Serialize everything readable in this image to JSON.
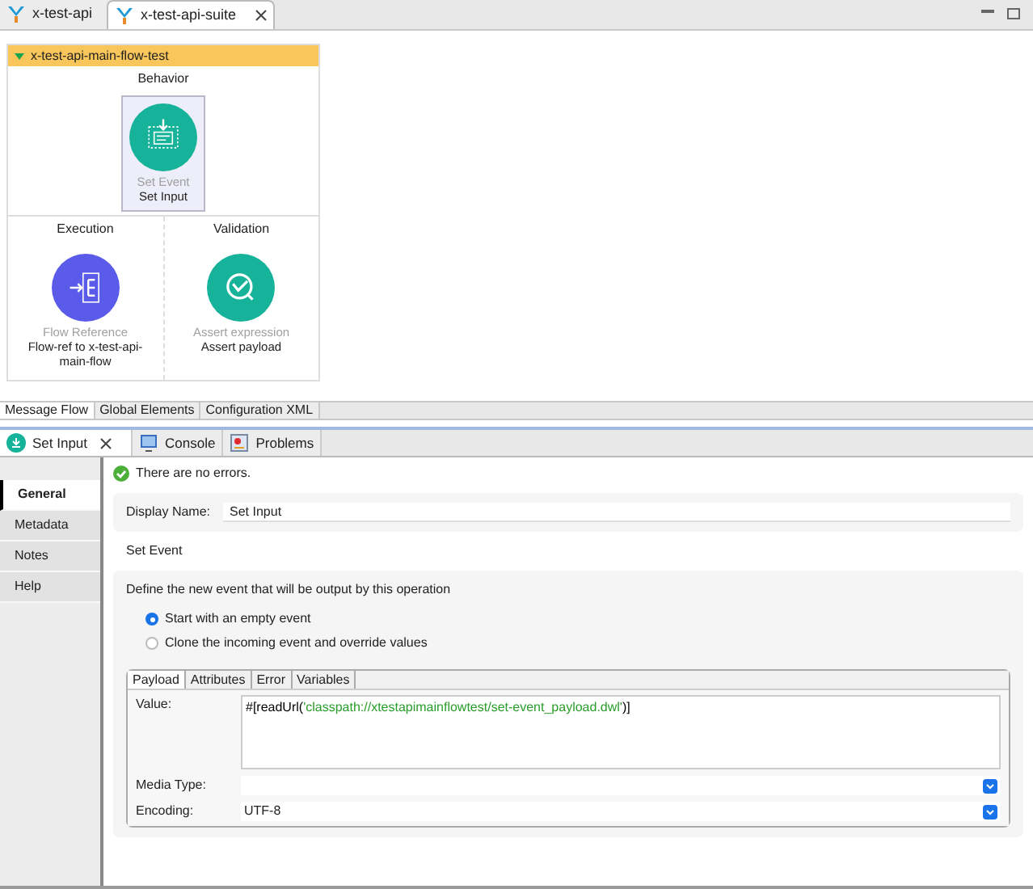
{
  "editor_tabs": [
    {
      "label": "x-test-api",
      "selected": false,
      "closable": false
    },
    {
      "label": "x-test-api-suite",
      "selected": true,
      "closable": true
    }
  ],
  "flow": {
    "title": "x-test-api-main-flow-test",
    "expanded": true,
    "behavior": {
      "heading": "Behavior",
      "kind": "set-event",
      "type": "Set Event",
      "name": "Set Input",
      "selected": true
    },
    "sections": [
      {
        "heading": "Execution",
        "kind": "flow-ref",
        "type": "Flow Reference",
        "name": "Flow-ref to x-test-api-main-flow",
        "selected": false
      },
      {
        "heading": "Validation",
        "kind": "assert",
        "type": "Assert expression",
        "name": "Assert payload",
        "selected": false
      }
    ]
  },
  "canvas_tabs": [
    {
      "label": "Message Flow",
      "selected": true
    },
    {
      "label": "Global Elements",
      "selected": false
    },
    {
      "label": "Configuration XML",
      "selected": false
    }
  ],
  "view_tabs": [
    {
      "label": "Set Input",
      "kind": "set-event",
      "selected": true,
      "closable": true
    },
    {
      "label": "Console",
      "kind": "console",
      "selected": false,
      "closable": false
    },
    {
      "label": "Problems",
      "kind": "problems",
      "selected": false,
      "closable": false
    }
  ],
  "sidebar": {
    "items": [
      {
        "label": "General",
        "selected": true
      },
      {
        "label": "Metadata",
        "selected": false
      },
      {
        "label": "Notes",
        "selected": false
      },
      {
        "label": "Help",
        "selected": false
      }
    ]
  },
  "status": "There are no errors.",
  "display_name": {
    "label": "Display Name:",
    "value": "Set Input"
  },
  "set_event": {
    "heading": "Set Event",
    "description": "Define the new event that will be output by this operation",
    "options": [
      {
        "label": "Start with an empty event",
        "selected": true
      },
      {
        "label": "Clone the incoming event and override values",
        "selected": false
      }
    ],
    "tabs": [
      {
        "label": "Payload",
        "selected": true
      },
      {
        "label": "Attributes",
        "selected": false
      },
      {
        "label": "Error",
        "selected": false
      },
      {
        "label": "Variables",
        "selected": false
      }
    ],
    "value": {
      "label": "Value:",
      "segments": [
        {
          "kind": "plain",
          "text": "#[readUrl("
        },
        {
          "kind": "string",
          "text": "'classpath://xtestapimainflowtest/set-event_payload.dwl'"
        },
        {
          "kind": "plain",
          "text": ")]"
        }
      ]
    },
    "media_type": {
      "label": "Media Type:"
    },
    "encoding": {
      "label": "Encoding:",
      "value": "UTF-8"
    }
  }
}
